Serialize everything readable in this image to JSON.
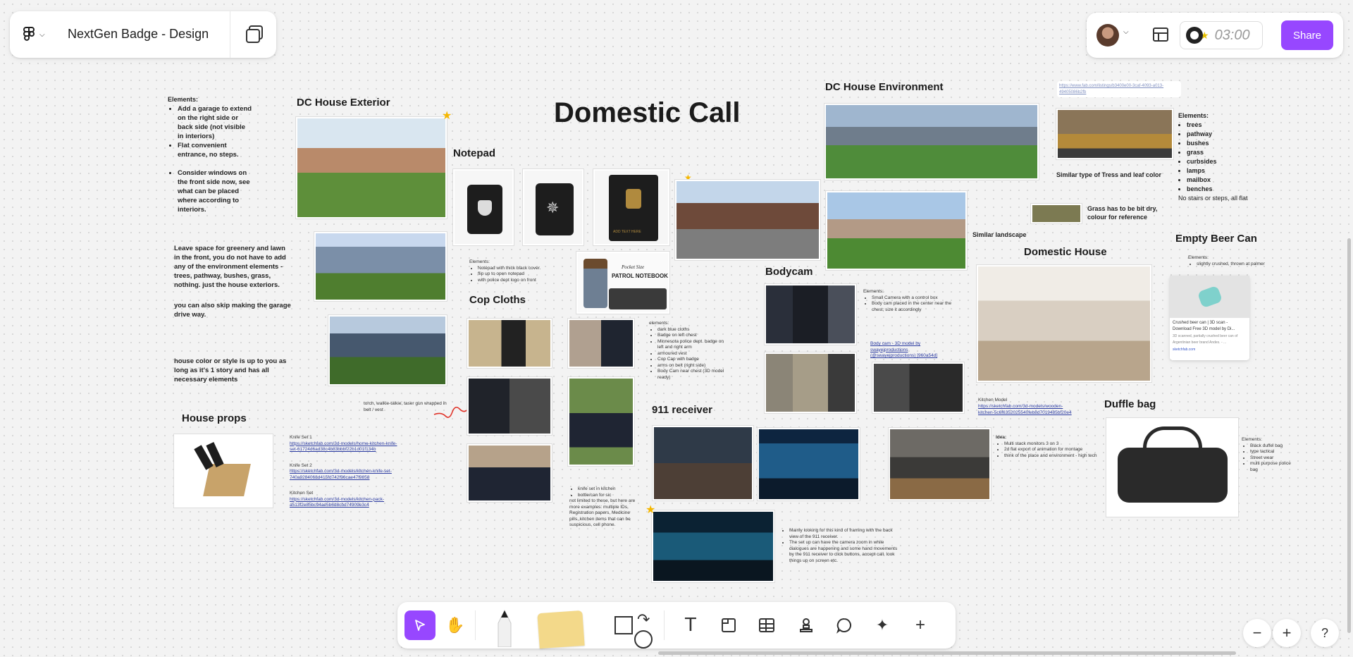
{
  "header": {
    "file_name": "NextGen Badge - Design",
    "timer": "03:00",
    "share_label": "Share"
  },
  "board": {
    "main_title": "Domestic Call",
    "sections": {
      "dc_house_exterior": "DC House Exterior",
      "notepad": "Notepad",
      "dc_house_environment": "DC House Environment",
      "similar_landscape": "Similar landscape",
      "domestic_house": "Domestic House",
      "empty_beer_can": "Empty Beer Can",
      "bodycam": "Bodycam",
      "cop_cloths": "Cop Cloths",
      "receiver_911": "911 receiver",
      "house_props": "House props",
      "duffle_bag": "Duffle bag"
    },
    "notes": {
      "elements_title": "Elements:",
      "exterior_items": [
        "Add a garage to extend on the right side or back side (not visible in interiors)",
        "Flat convenient entrance, no steps.",
        "Consider windows on the front side now, see what can be placed where according to interiors."
      ],
      "greenery_note": "Leave space for greenery and lawn in the front, you do not have to add any of the environment elements - trees, pathway, bushes, grass, nothing. just the house exteriors.",
      "garage_note": "you can also skip making the garage drive way.",
      "color_note": "house color or style is up to you as long as it's 1 story and has all necessary elements",
      "env_url": "https://www.fab.com/listings/b3400e00-3caf-4093-a013-49405086b2fb",
      "env_elements_title": "Elements:",
      "env_items": [
        "trees",
        "pathway",
        "bushes",
        "grass",
        "curbsides",
        "lamps",
        "mailbox",
        "benches"
      ],
      "env_no_stairs": "No stairs or steps, all flat",
      "trees_note": "Similar type of Tress and leaf color",
      "grass_note": "Grass has to be bit dry, colour for reference",
      "notepad_elements": [
        "Elements:",
        "Notepad with thick black cover.",
        "flip up to open notepad",
        "with police dept logo on front"
      ],
      "pocket_text": "Pocket Size",
      "patrol_text": "PATROL NOTEBOOK",
      "notepad_caption": "ADD TEXT HERE",
      "cop_elements": [
        "elements:",
        "dark blue cloths",
        "Badge on left chest",
        "Minnesota police dept. badge on left and right arm",
        "armoured vest",
        "Cop Cap with badge",
        "arms on belt (right side)",
        "Body Cam near chest (3D model ready)"
      ],
      "bodycam_elements": [
        "Elements:",
        "Small Camera with a control box",
        "Body cam placed in the center near the chest, size it accordingly"
      ],
      "bodycam_link": "Body cam - 3D model by swayejproductions (@swayejproductions) [960a54d]",
      "beer_elements": [
        "Elements:",
        "slightly crushed, thrown at palmer"
      ],
      "beer_card_title": "Crushed beer can | 3D scan - Download Free 3D model by Di...",
      "beer_card_desc": "3D scanned, partially crushed beer can of Argentinian beer brand Andes. - ...",
      "beer_card_site": "sketchfab.com",
      "kitchen_model_label": "Kitchen Model",
      "kitchen_model_url": "https://sketchfab.com/3d-models/wooden-kitchen-5c6f6352025540feb8d7019485bf20e4",
      "idea_title": "Idea:",
      "idea_items": [
        "Multi stack monitors 3 on 3",
        "2d flat export of animation for montage",
        "think of the place and environment - high tech"
      ],
      "receiver_note": [
        "Mainly looking for this kind of framing with the back view of the 911 receiver.",
        "The set up can have the camera zoom in while dialogues are happening and some hand movements by the 911 receiver to click buttons, accept call, look things up on screen etc."
      ],
      "taser_note": "torch, walkie-talkie, taser gun wrapped in belt / vest",
      "knife_items": [
        "knife set in kitchen",
        "bottle/can for sic"
      ],
      "knife_more": "not limited to these, but here are more examples: multiple IDs, Registration papers, Medicine pills, kitchen items that can be suspicious, cell phone.",
      "duffle_elements": [
        "Elements:",
        "Black duffel bag",
        "type tactical",
        "Street wear",
        "multi purpose police bag"
      ],
      "props_links": [
        {
          "label": "Knife Set 1",
          "url": "https://sketchfab.com/3d-models/home-kitchen-knife-set-61724d6ad38c4b83bbbf22b1d01f134b"
        },
        {
          "label": "Knife Set 2",
          "url": "https://sketchfab.com/3d-models/kitchen-knife-set-740a9284068d415fd742f96cae47f9858"
        },
        {
          "label": "Kitchen Set",
          "url": "https://sketchfab.com/3d-models/kitchen-pack-a513f2e85bc94ae5b6d8cbd74909e3c4"
        }
      ]
    }
  },
  "toolbar": {
    "tools": [
      "move-tool",
      "hand-tool",
      "pen-tool",
      "sticky-note-tool",
      "shape-tool",
      "connector-tool",
      "text-tool",
      "section-tool",
      "table-tool",
      "stamp-tool",
      "comment-tool",
      "ai-tool",
      "more-tool"
    ]
  },
  "zoom": {
    "out": "−",
    "in": "+",
    "help": "?"
  },
  "colors": {
    "accent": "#9747ff",
    "canvas": "#f3f3f3",
    "star": "#f5b700"
  }
}
